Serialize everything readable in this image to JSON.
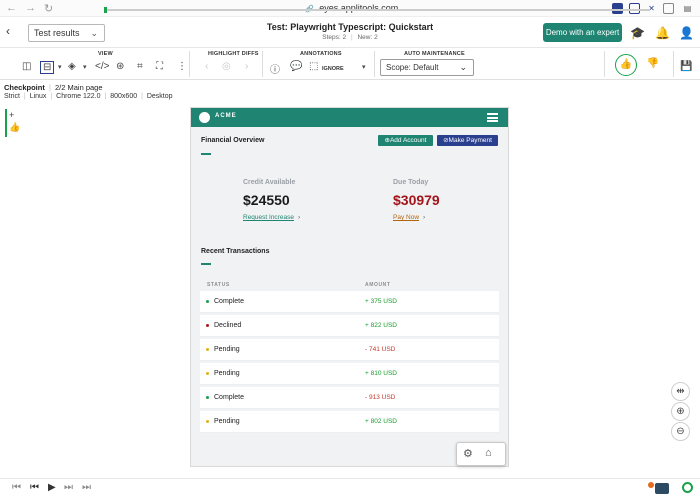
{
  "browser": {
    "url": "eyes.applitools.com",
    "back_glyph": "←",
    "forward_glyph": "→",
    "reload_glyph": "↻",
    "link_glyph": "🔗"
  },
  "header": {
    "results_select": "Test results",
    "title": "Test:  Playwright Typescript: Quickstart",
    "steps_label": "Steps: 2",
    "new_label": "New: 2",
    "demo_button": "Demo with an expert"
  },
  "toolbar": {
    "view_label": "VIEW",
    "highlight_label": "HIGHLIGHT DIFFS",
    "annotations_label": "ANNOTATIONS",
    "auto_label": "AUTO MAINTENANCE",
    "ignore_label": "IGNORE",
    "scope_select": "Scope: Default"
  },
  "checkpoint": {
    "label": "Checkpoint",
    "page": "2/2 Main page",
    "match_level": "Strict",
    "os": "Linux",
    "browser": "Chrome 122.0",
    "viewport": "800x600",
    "device": "Desktop"
  },
  "screenshot": {
    "brand": "ACME",
    "section_title": "Financial Overview",
    "add_account": "⊕Add Account",
    "make_payment": "⊘Make Payment",
    "credit_label": "Credit Available",
    "credit_value": "$24550",
    "credit_link": "Request Increase",
    "due_label": "Due Today",
    "due_value": "$30979",
    "due_link": "Pay Now",
    "transactions_title": "Recent Transactions",
    "col_status": "STATUS",
    "col_amount": "AMOUNT",
    "transactions": [
      {
        "status": "Complete",
        "amount": "+ 375 USD",
        "dot": "#1aa24a",
        "color": "#1a9a2a"
      },
      {
        "status": "Declined",
        "amount": "+ 822 USD",
        "dot": "#b01818",
        "color": "#1a9a2a"
      },
      {
        "status": "Pending",
        "amount": "- 741 USD",
        "dot": "#e2b21a",
        "color": "#c0392b"
      },
      {
        "status": "Pending",
        "amount": "+ 810 USD",
        "dot": "#e2b21a",
        "color": "#1a9a2a"
      },
      {
        "status": "Complete",
        "amount": "- 913 USD",
        "dot": "#1aa24a",
        "color": "#c0392b"
      },
      {
        "status": "Pending",
        "amount": "+ 802 USD",
        "dot": "#e2b21a",
        "color": "#1a9a2a"
      }
    ]
  },
  "colors": {
    "accent": "#1f8472",
    "navy": "#2b3f8f",
    "due_red": "#a3151b"
  }
}
